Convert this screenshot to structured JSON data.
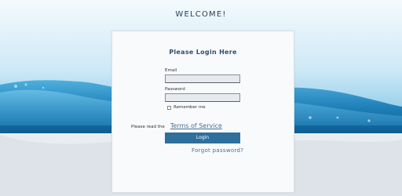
{
  "header": {
    "welcome": "WELCOME!"
  },
  "login": {
    "title": "Please Login Here",
    "email_label": "Email",
    "email_value": "",
    "password_label": "Password",
    "password_value": "",
    "remember_label": "Remember me",
    "remember_checked": false,
    "terms_prefix": "Please read the",
    "terms_link": "Terms of Service",
    "login_button": "Login",
    "forgot_link": "Forgot password?"
  },
  "colors": {
    "accent": "#2e6f9c",
    "link": "#4a6f8f",
    "water": "#3aa3d6"
  }
}
